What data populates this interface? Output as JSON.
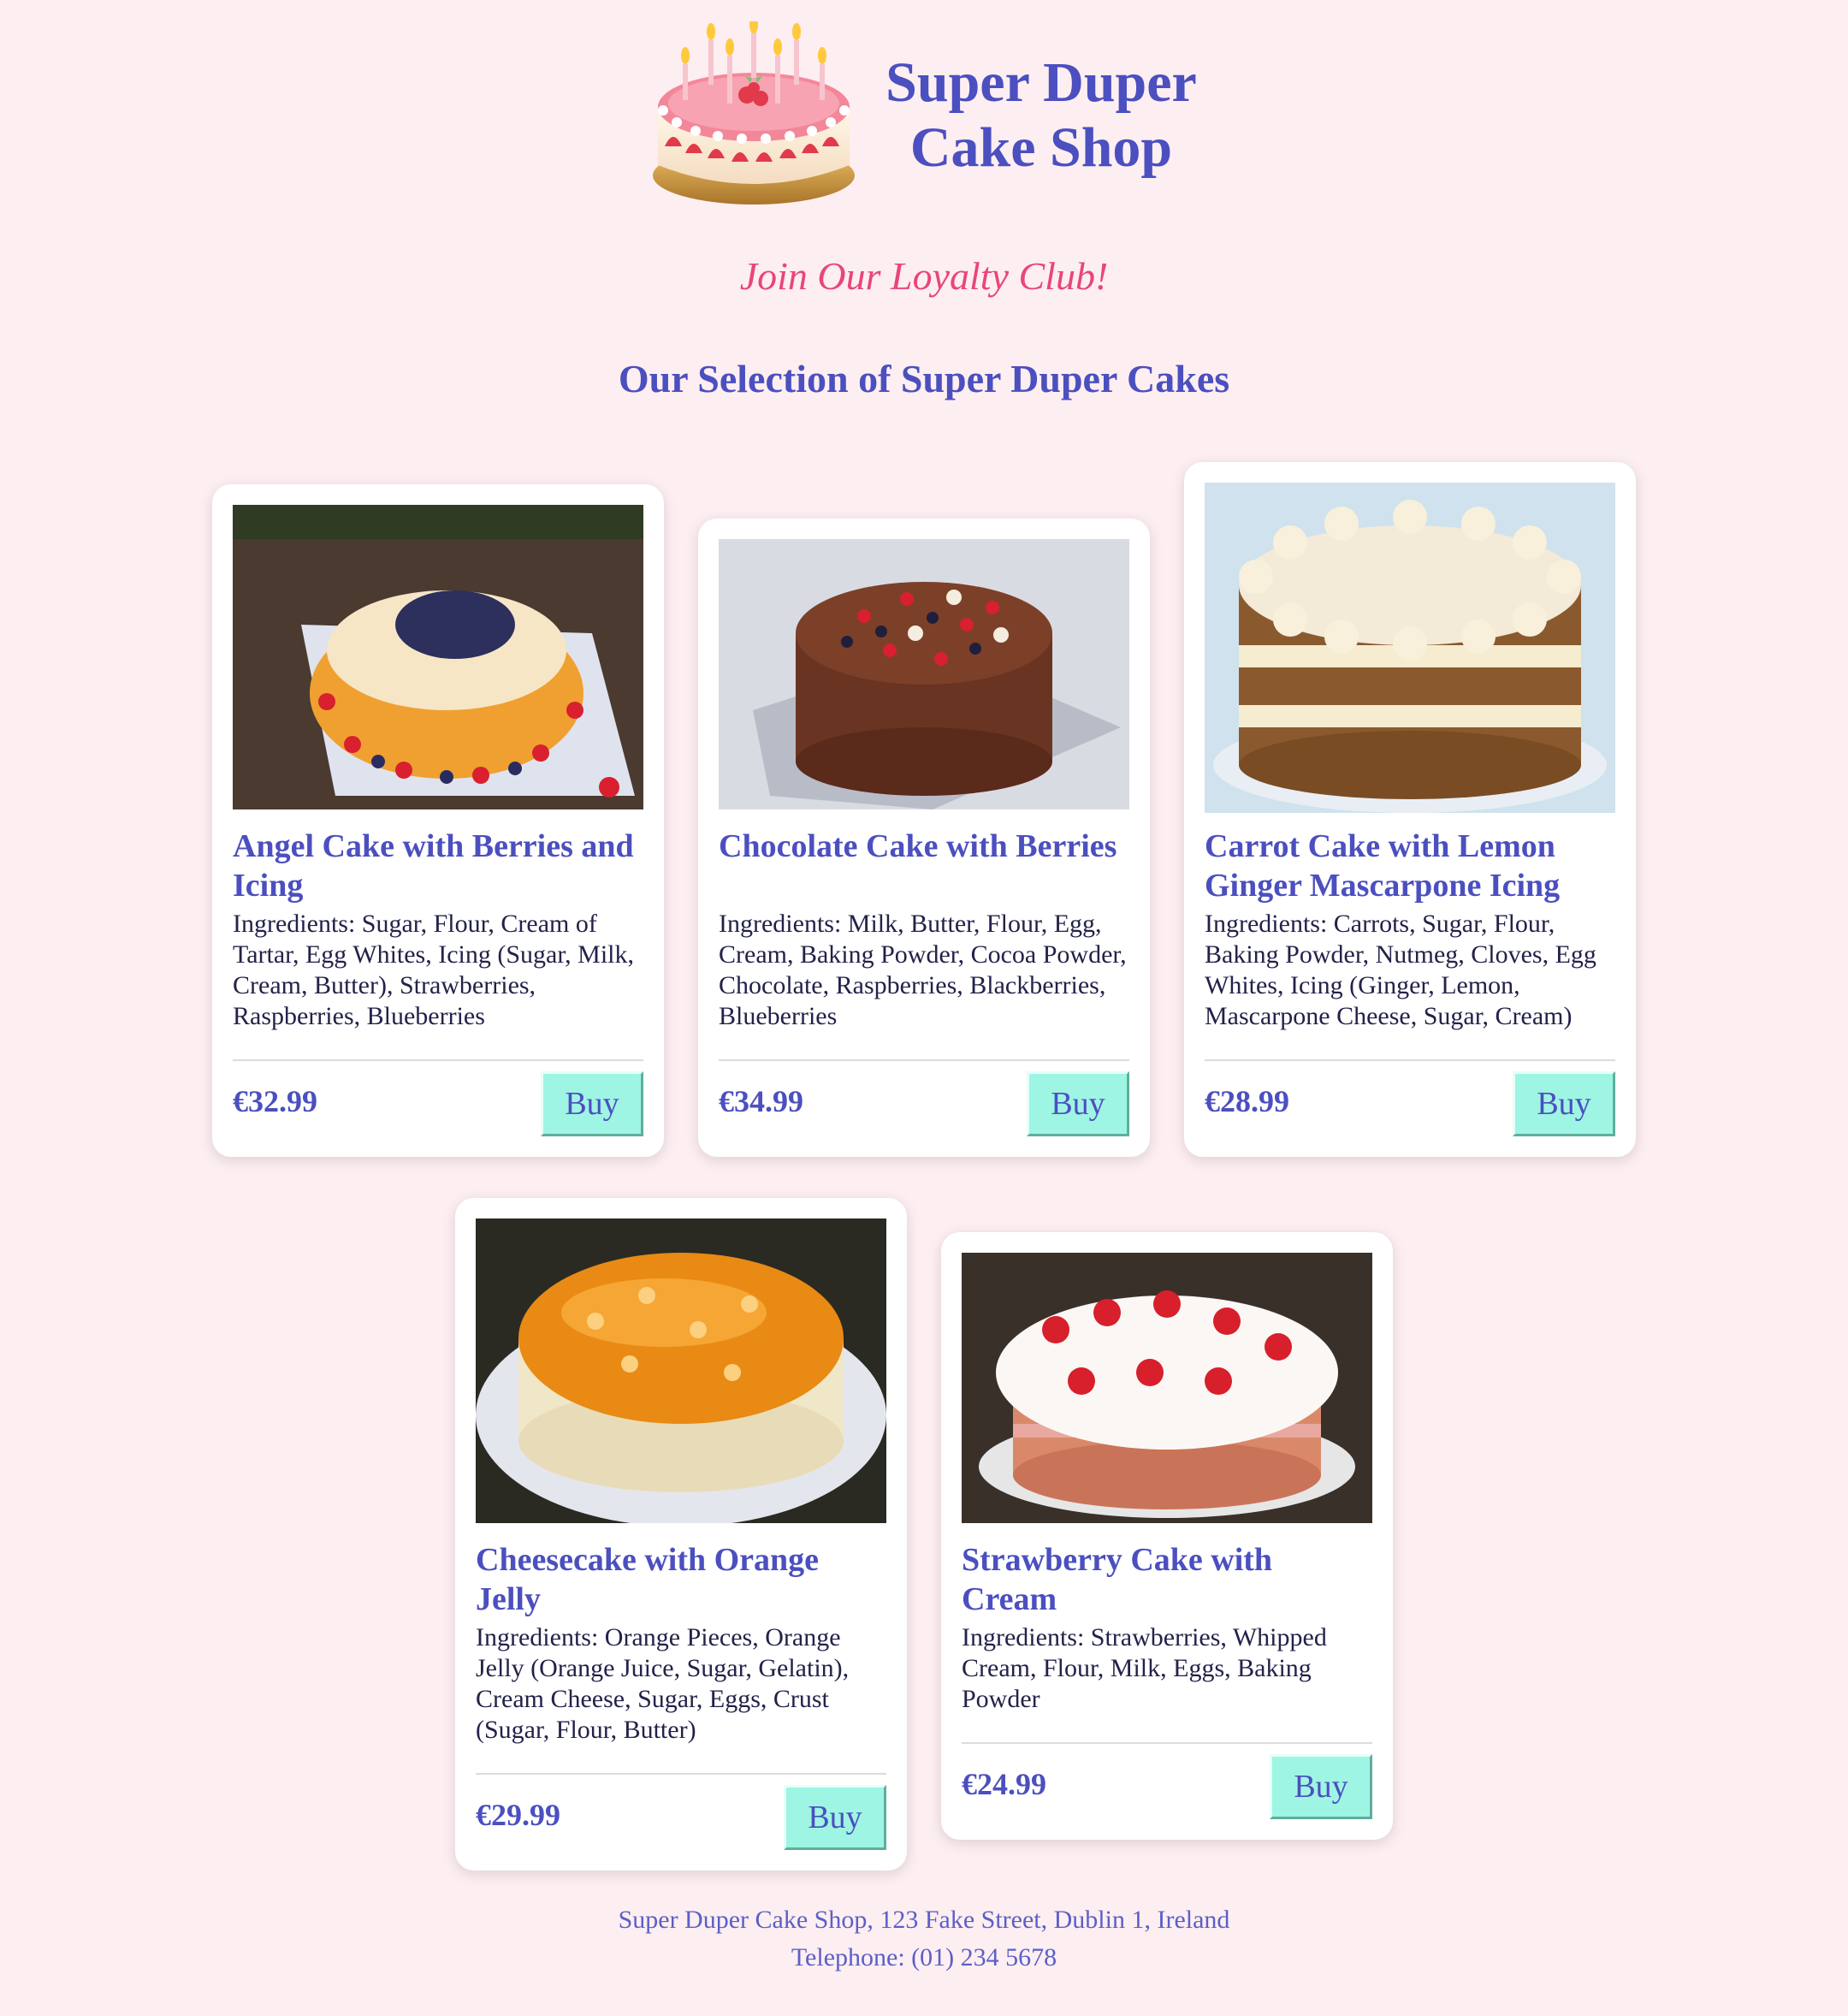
{
  "header": {
    "logo_icon": "birthday-cake-icon",
    "title_line1": "Super Duper",
    "title_line2": "Cake Shop"
  },
  "loyalty_link": "Join Our Loyalty Club!",
  "section_title": "Our Selection of Super Duper Cakes",
  "cakes": [
    {
      "name": "Angel Cake with Berries and Icing",
      "ingredients": "Ingredients: Sugar, Flour, Cream of Tartar, Egg Whites, Icing (Sugar, Milk, Cream, Butter), Strawberries, Raspberries, Blueberries",
      "price": "€32.99",
      "buy_label": "Buy",
      "image": "angel-cake-photo"
    },
    {
      "name": "Chocolate Cake with Berries",
      "ingredients": "Ingredients: Milk, Butter, Flour, Egg, Cream, Baking Powder, Cocoa Powder, Chocolate, Raspberries, Blackberries, Blueberries",
      "price": "€34.99",
      "buy_label": "Buy",
      "image": "chocolate-cake-photo"
    },
    {
      "name": "Carrot Cake with Lemon Ginger Mascarpone Icing",
      "ingredients": "Ingredients: Carrots, Sugar, Flour, Baking Powder, Nutmeg, Cloves, Egg Whites, Icing (Ginger, Lemon, Mascarpone Cheese, Sugar, Cream)",
      "price": "€28.99",
      "buy_label": "Buy",
      "image": "carrot-cake-photo"
    },
    {
      "name": "Cheesecake with Orange Jelly",
      "ingredients": "Ingredients: Orange Pieces, Orange Jelly (Orange Juice, Sugar, Gelatin), Cream Cheese, Sugar, Eggs, Crust (Sugar, Flour, Butter)",
      "price": "€29.99",
      "buy_label": "Buy",
      "image": "cheesecake-photo"
    },
    {
      "name": "Strawberry Cake with Cream",
      "ingredients": "Ingredients: Strawberries, Whipped Cream, Flour, Milk, Eggs, Baking Powder",
      "price": "€24.99",
      "buy_label": "Buy",
      "image": "strawberry-cake-photo"
    }
  ],
  "footer": {
    "address": "Super Duper Cake Shop, 123 Fake Street, Dublin 1, Ireland",
    "telephone": "Telephone: (01) 234 5678"
  },
  "colors": {
    "background": "#fdeef1",
    "heading": "#4b4fbf",
    "loyalty": "#e8467a",
    "buy_button": "#9ef5e3"
  }
}
